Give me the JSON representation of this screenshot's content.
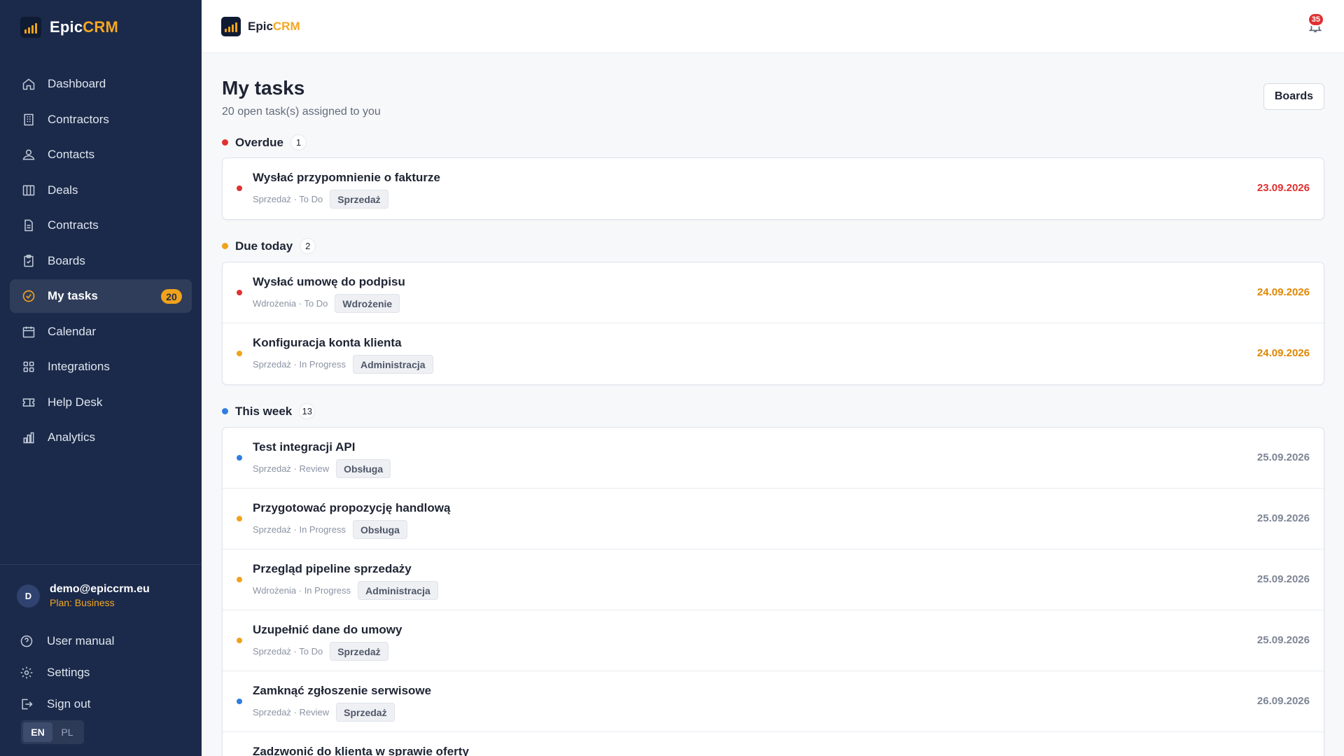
{
  "app": {
    "brand_prefix": "Epic",
    "brand_suffix": "CRM"
  },
  "sidebar": {
    "items": [
      {
        "label": "Dashboard",
        "icon": "home-icon"
      },
      {
        "label": "Contractors",
        "icon": "building-icon"
      },
      {
        "label": "Contacts",
        "icon": "contacts-icon"
      },
      {
        "label": "Deals",
        "icon": "columns-icon"
      },
      {
        "label": "Contracts",
        "icon": "document-icon"
      },
      {
        "label": "Boards",
        "icon": "clipboard-icon"
      },
      {
        "label": "My tasks",
        "icon": "check-circle-icon",
        "badge": "20",
        "active": true
      },
      {
        "label": "Calendar",
        "icon": "calendar-icon"
      },
      {
        "label": "Integrations",
        "icon": "grid-icon"
      },
      {
        "label": "Help Desk",
        "icon": "ticket-icon"
      },
      {
        "label": "Analytics",
        "icon": "bar-chart-icon"
      }
    ],
    "user": {
      "initial": "D",
      "email": "demo@epiccrm.eu",
      "plan": "Plan: Business"
    },
    "bottom_links": [
      {
        "label": "User manual",
        "icon": "help-circle-icon"
      },
      {
        "label": "Settings",
        "icon": "gear-icon"
      },
      {
        "label": "Sign out",
        "icon": "sign-out-icon"
      }
    ],
    "languages": [
      "EN",
      "PL"
    ],
    "active_language": "EN"
  },
  "topbar": {
    "notification_count": "35"
  },
  "page": {
    "title": "My tasks",
    "subtitle": "20 open task(s) assigned to you",
    "boards_button": "Boards"
  },
  "colors": {
    "red": "#e03131",
    "orange": "#f0a21a",
    "blue": "#2f7de1",
    "date_red": "#e03131",
    "date_orange": "#e08600",
    "date_gray": "#7d8595"
  },
  "sections": [
    {
      "label": "Overdue",
      "count": "1",
      "color": "#e03131",
      "tasks": [
        {
          "title": "Wysłać przypomnienie o fakturze",
          "meta": "Sprzedaż · To Do",
          "tag": "Sprzedaż",
          "date": "23.09.2026",
          "priority_color": "#e03131",
          "date_color": "#e03131"
        }
      ]
    },
    {
      "label": "Due today",
      "count": "2",
      "color": "#f0a21a",
      "tasks": [
        {
          "title": "Wysłać umowę do podpisu",
          "meta": "Wdrożenia · To Do",
          "tag": "Wdrożenie",
          "date": "24.09.2026",
          "priority_color": "#e03131",
          "date_color": "#e08600"
        },
        {
          "title": "Konfiguracja konta klienta",
          "meta": "Sprzedaż · In Progress",
          "tag": "Administracja",
          "date": "24.09.2026",
          "priority_color": "#f0a21a",
          "date_color": "#e08600"
        }
      ]
    },
    {
      "label": "This week",
      "count": "13",
      "color": "#2f7de1",
      "tasks": [
        {
          "title": "Test integracji API",
          "meta": "Sprzedaż · Review",
          "tag": "Obsługa",
          "date": "25.09.2026",
          "priority_color": "#2f7de1",
          "date_color": "#7d8595"
        },
        {
          "title": "Przygotować propozycję handlową",
          "meta": "Sprzedaż · In Progress",
          "tag": "Obsługa",
          "date": "25.09.2026",
          "priority_color": "#f0a21a",
          "date_color": "#7d8595"
        },
        {
          "title": "Przegląd pipeline sprzedaży",
          "meta": "Wdrożenia · In Progress",
          "tag": "Administracja",
          "date": "25.09.2026",
          "priority_color": "#f0a21a",
          "date_color": "#7d8595"
        },
        {
          "title": "Uzupełnić dane do umowy",
          "meta": "Sprzedaż · To Do",
          "tag": "Sprzedaż",
          "date": "25.09.2026",
          "priority_color": "#f0a21a",
          "date_color": "#7d8595"
        },
        {
          "title": "Zamknąć zgłoszenie serwisowe",
          "meta": "Sprzedaż · Review",
          "tag": "Sprzedaż",
          "date": "26.09.2026",
          "priority_color": "#2f7de1",
          "date_color": "#7d8595"
        },
        {
          "title": "Zadzwonić do klienta w sprawie oferty",
          "meta": "",
          "tag": "",
          "date": "",
          "priority_color": "#2f7de1",
          "date_color": "#7d8595"
        }
      ]
    }
  ]
}
